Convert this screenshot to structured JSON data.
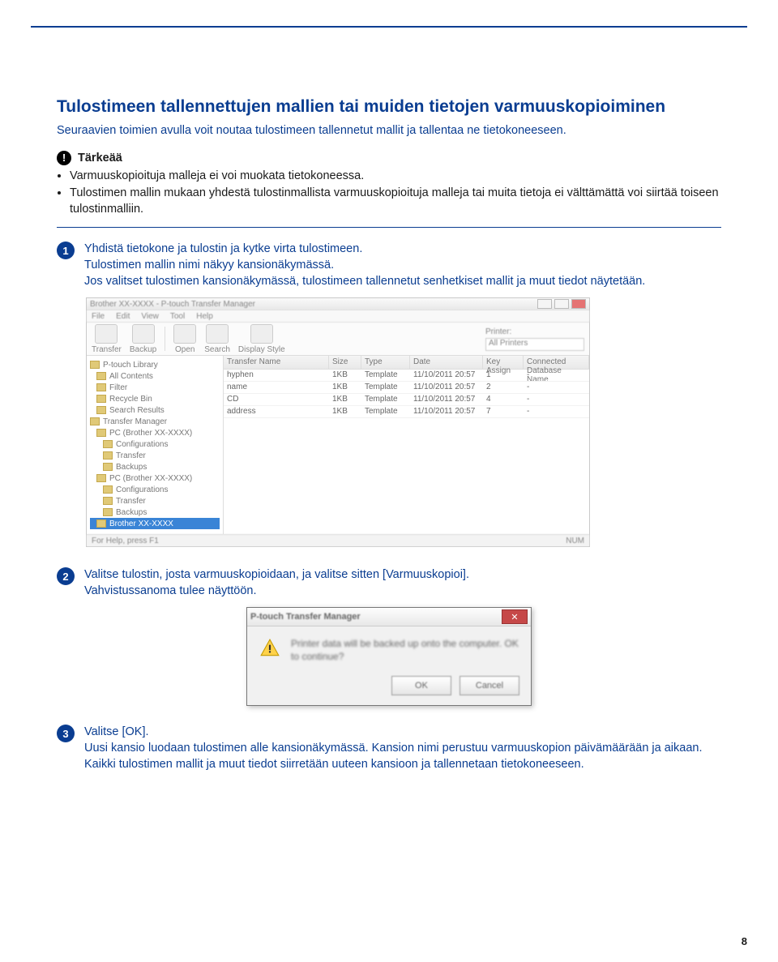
{
  "page_number": "8",
  "heading": "Tulostimeen tallennettujen mallien tai muiden tietojen varmuuskopioiminen",
  "lead": "Seuraavien toimien avulla voit noutaa tulostimeen tallennetut mallit ja tallentaa ne tietokoneeseen.",
  "important": {
    "label": "Tärkeää",
    "items": [
      "Varmuuskopioituja malleja ei voi muokata tietokoneessa.",
      "Tulostimen mallin mukaan yhdestä tulostinmallista varmuuskopioituja malleja tai muita tietoja ei välttämättä voi siirtää toiseen tulostinmalliin."
    ]
  },
  "steps": [
    {
      "num": "1",
      "lines": [
        "Yhdistä tietokone ja tulostin ja kytke virta tulostimeen.",
        "Tulostimen mallin nimi näkyy kansionäkymässä.",
        "Jos valitset tulostimen kansionäkymässä, tulostimeen tallennetut senhetkiset mallit ja muut tiedot näytetään."
      ]
    },
    {
      "num": "2",
      "lines": [
        "Valitse tulostin, josta varmuuskopioidaan, ja valitse sitten [Varmuuskopioi].",
        "Vahvistussanoma tulee näyttöön."
      ]
    },
    {
      "num": "3",
      "lines": [
        "Valitse [OK].",
        "Uusi kansio luodaan tulostimen alle kansionäkymässä. Kansion nimi perustuu varmuuskopion päivämäärään ja aikaan. Kaikki tulostimen mallit ja muut tiedot siirretään uuteen kansioon ja tallennetaan tietokoneeseen."
      ]
    }
  ],
  "app": {
    "title": "Brother XX-XXXX - P-touch Transfer Manager",
    "menus": [
      "File",
      "Edit",
      "View",
      "Tool",
      "Help"
    ],
    "toolbar": [
      "Transfer",
      "Backup",
      "Open",
      "Search",
      "Display Style"
    ],
    "printer_label": "Printer:",
    "printer_value": "All Printers",
    "columns": [
      "Transfer Name",
      "Size",
      "Type",
      "Date",
      "Key Assign",
      "Connected Database Name"
    ],
    "rows": [
      {
        "name": "hyphen",
        "size": "1KB",
        "type": "Template",
        "date": "11/10/2011 20:57",
        "key": "1",
        "db": "-"
      },
      {
        "name": "name",
        "size": "1KB",
        "type": "Template",
        "date": "11/10/2011 20:57",
        "key": "2",
        "db": "-"
      },
      {
        "name": "CD",
        "size": "1KB",
        "type": "Template",
        "date": "11/10/2011 20:57",
        "key": "4",
        "db": "-"
      },
      {
        "name": "address",
        "size": "1KB",
        "type": "Template",
        "date": "11/10/2011 20:57",
        "key": "7",
        "db": "-"
      }
    ],
    "tree": [
      "P-touch Library",
      " All Contents",
      " Filter",
      " Recycle Bin",
      " Search Results",
      "Transfer Manager",
      " PC (Brother XX-XXXX)",
      "  Configurations",
      "  Transfer",
      "  Backups",
      " PC (Brother XX-XXXX)",
      "  Configurations",
      "  Transfer",
      "  Backups",
      " Brother XX-XXXX"
    ],
    "tree_selected": " Brother XX-XXXX",
    "statusbar_left": "For Help, press F1",
    "statusbar_right": "NUM"
  },
  "dialog": {
    "title": "P-touch Transfer Manager",
    "message": "Printer data will be backed up onto the computer. OK to continue?",
    "ok": "OK",
    "cancel": "Cancel"
  }
}
